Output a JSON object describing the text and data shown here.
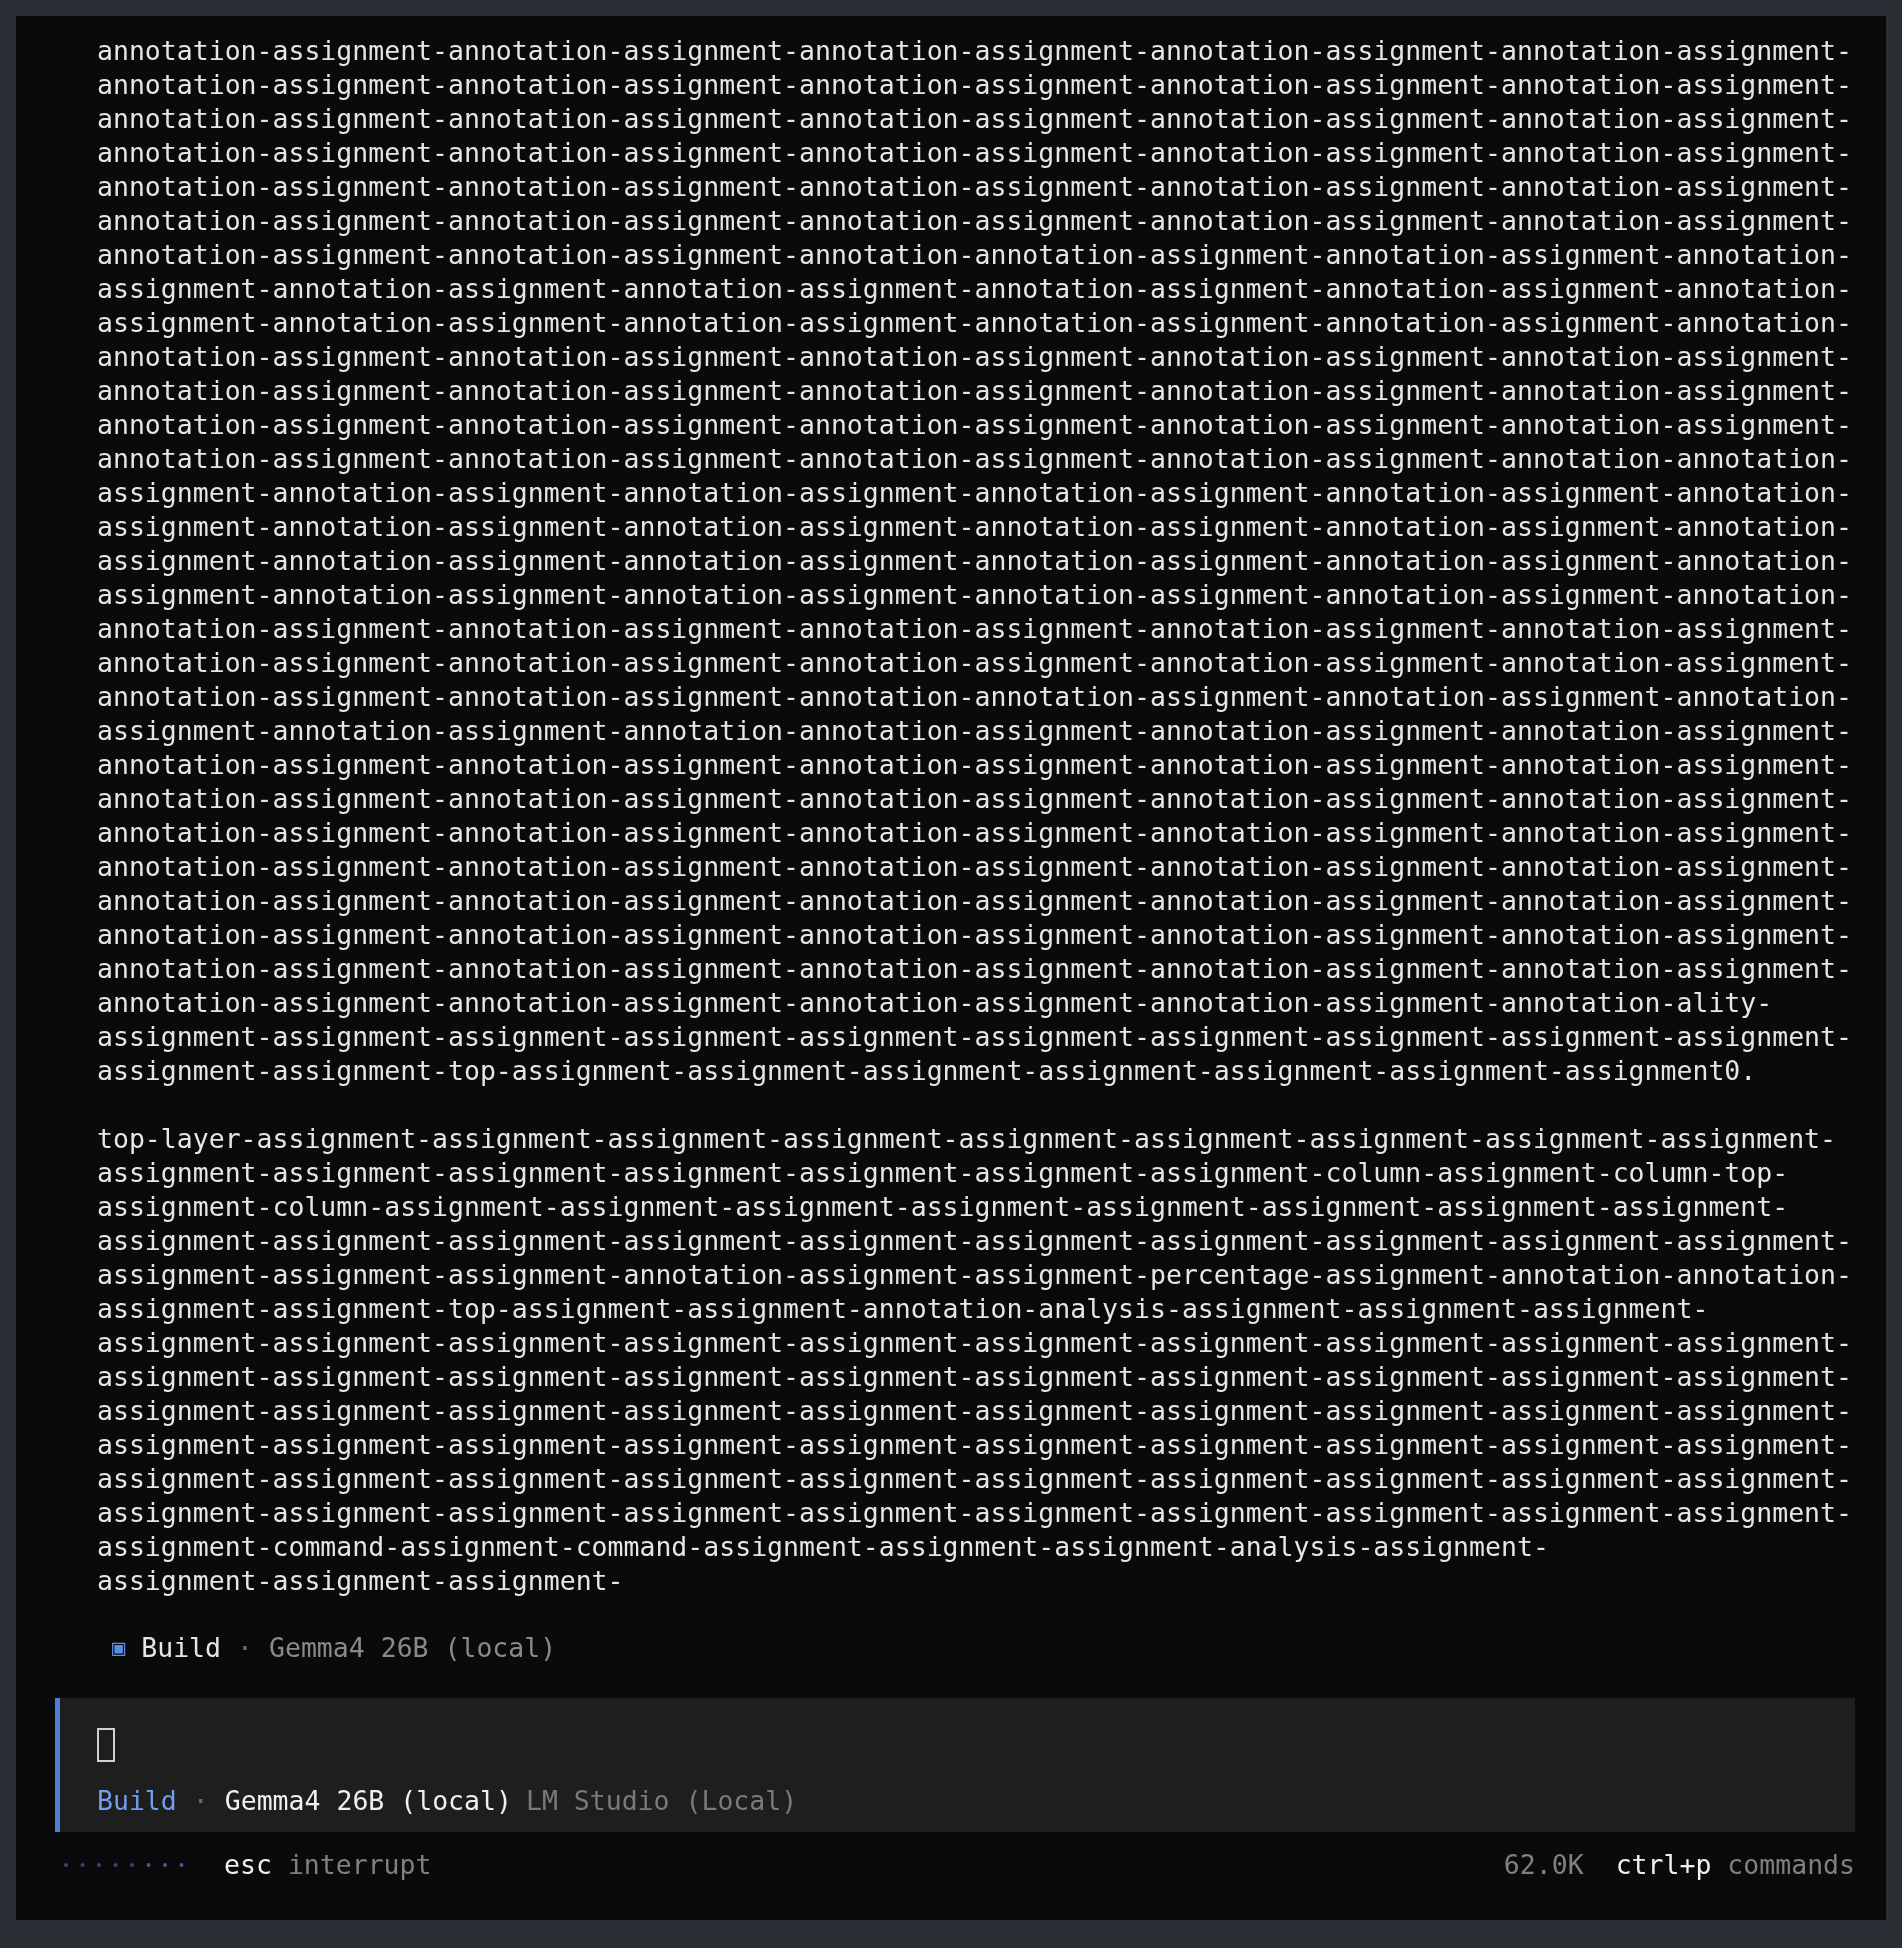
{
  "messages": [
    {
      "lines": [
        "annotation-assignment-annotation-assignment-annotation-assignment-annotation-assignment-annotation-assignment-",
        "annotation-assignment-annotation-assignment-annotation-assignment-annotation-assignment-annotation-assignment-",
        "annotation-assignment-annotation-assignment-annotation-assignment-annotation-assignment-annotation-assignment-",
        "annotation-assignment-annotation-assignment-annotation-assignment-annotation-assignment-annotation-assignment-",
        "annotation-assignment-annotation-assignment-annotation-assignment-annotation-assignment-annotation-assignment-",
        "annotation-assignment-annotation-assignment-annotation-assignment-annotation-assignment-annotation-assignment-",
        "annotation-assignment-annotation-assignment-annotation-annotation-assignment-annotation-assignment-annotation-",
        "assignment-annotation-assignment-annotation-assignment-annotation-assignment-annotation-assignment-annotation-",
        "assignment-annotation-assignment-annotation-assignment-annotation-assignment-annotation-assignment-annotation-",
        "annotation-assignment-annotation-assignment-annotation-assignment-annotation-assignment-annotation-assignment-",
        "annotation-assignment-annotation-assignment-annotation-assignment-annotation-assignment-annotation-assignment-",
        "annotation-assignment-annotation-assignment-annotation-assignment-annotation-assignment-annotation-assignment-",
        "annotation-assignment-annotation-assignment-annotation-assignment-annotation-assignment-annotation-annotation-",
        "assignment-annotation-assignment-annotation-assignment-annotation-assignment-annotation-assignment-annotation-",
        "assignment-annotation-assignment-annotation-assignment-annotation-assignment-annotation-assignment-annotation-",
        "assignment-annotation-assignment-annotation-assignment-annotation-assignment-annotation-assignment-annotation-",
        "assignment-annotation-assignment-annotation-assignment-annotation-assignment-annotation-assignment-annotation-",
        "annotation-assignment-annotation-assignment-annotation-assignment-annotation-assignment-annotation-assignment-",
        "annotation-assignment-annotation-assignment-annotation-assignment-annotation-assignment-annotation-assignment-",
        "annotation-assignment-annotation-assignment-annotation-annotation-assignment-annotation-assignment-annotation-",
        "assignment-annotation-assignment-annotation-annotation-assignment-annotation-assignment-annotation-assignment-",
        "annotation-assignment-annotation-assignment-annotation-assignment-annotation-assignment-annotation-assignment-",
        "annotation-assignment-annotation-assignment-annotation-assignment-annotation-assignment-annotation-assignment-",
        "annotation-assignment-annotation-assignment-annotation-assignment-annotation-assignment-annotation-assignment-",
        "annotation-assignment-annotation-assignment-annotation-assignment-annotation-assignment-annotation-assignment-",
        "annotation-assignment-annotation-assignment-annotation-assignment-annotation-assignment-annotation-assignment-",
        "annotation-assignment-annotation-assignment-annotation-assignment-annotation-assignment-annotation-assignment-",
        "annotation-assignment-annotation-assignment-annotation-assignment-annotation-assignment-annotation-assignment-",
        "annotation-assignment-annotation-assignment-annotation-assignment-annotation-assignment-annotation-ality-",
        "assignment-assignment-assignment-assignment-assignment-assignment-assignment-assignment-assignment-assignment-",
        "assignment-assignment-top-assignment-assignment-assignment-assignment-assignment-assignment-assignment0."
      ]
    },
    {
      "lines": [
        "top-layer-assignment-assignment-assignment-assignment-assignment-assignment-assignment-assignment-assignment-",
        "assignment-assignment-assignment-assignment-assignment-assignment-assignment-column-assignment-column-top-",
        "assignment-column-assignment-assignment-assignment-assignment-assignment-assignment-assignment-assignment-",
        "assignment-assignment-assignment-assignment-assignment-assignment-assignment-assignment-assignment-assignment-",
        "assignment-assignment-assignment-annotation-assignment-assignment-percentage-assignment-annotation-annotation-",
        "assignment-assignment-top-assignment-assignment-annotation-analysis-assignment-assignment-assignment-",
        "assignment-assignment-assignment-assignment-assignment-assignment-assignment-assignment-assignment-assignment-",
        "assignment-assignment-assignment-assignment-assignment-assignment-assignment-assignment-assignment-assignment-",
        "assignment-assignment-assignment-assignment-assignment-assignment-assignment-assignment-assignment-assignment-",
        "assignment-assignment-assignment-assignment-assignment-assignment-assignment-assignment-assignment-assignment-",
        "assignment-assignment-assignment-assignment-assignment-assignment-assignment-assignment-assignment-assignment-",
        "assignment-assignment-assignment-assignment-assignment-assignment-assignment-assignment-assignment-assignment-",
        "assignment-command-assignment-command-assignment-assignment-assignment-analysis-assignment-",
        "assignment-assignment-assignment-"
      ]
    }
  ],
  "status": {
    "icon": "▣",
    "mode": "Build",
    "separator": "·",
    "model": "Gemma4 26B (local)"
  },
  "prompt": {
    "mode": "Build",
    "separator": "·",
    "model": "Gemma4 26B (local)",
    "provider": "LM Studio (Local)"
  },
  "footer": {
    "key": "esc",
    "action": "interrupt",
    "tokens": "62.0K",
    "shortcut_key": "ctrl+p",
    "shortcut_action": "commands"
  }
}
